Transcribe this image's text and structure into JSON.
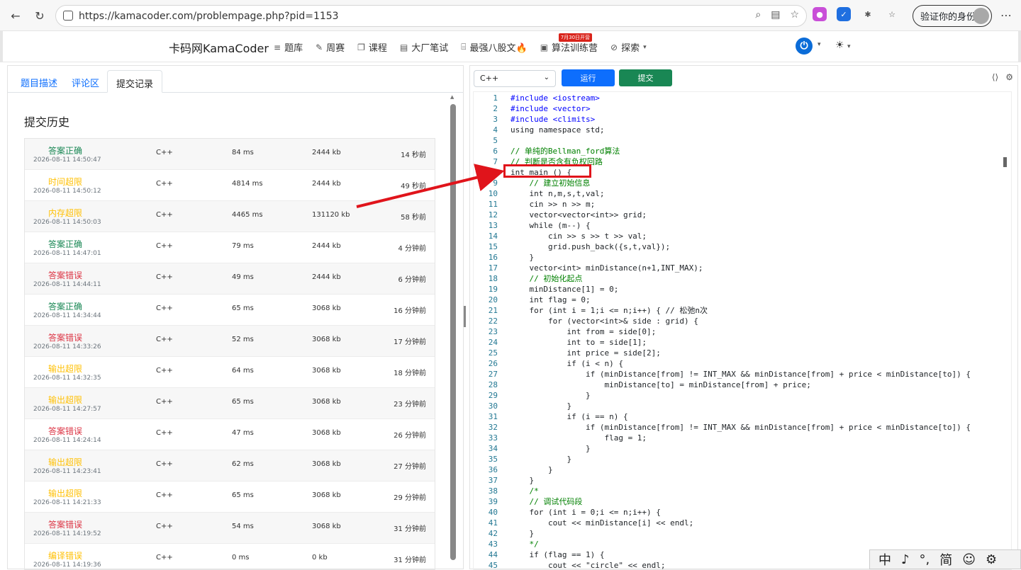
{
  "browser": {
    "url": "https://kamacoder.com/problempage.php?pid=1153",
    "profile_button": "验证你的身份"
  },
  "site": {
    "brand": "卡码网KamaCoder",
    "nav": [
      {
        "label": "题库",
        "icon": "list-icon"
      },
      {
        "label": "周赛",
        "icon": "pen-icon"
      },
      {
        "label": "课程",
        "icon": "book-icon"
      },
      {
        "label": "大厂笔试",
        "icon": "exam-icon"
      },
      {
        "label": "最强八股文🔥",
        "icon": "code-icon"
      },
      {
        "label": "算法训练营",
        "icon": "calendar-icon",
        "badge": "7月30日开营"
      },
      {
        "label": "探索",
        "icon": "compass-icon"
      }
    ]
  },
  "left": {
    "tabs": [
      "题目描述",
      "评论区",
      "提交记录"
    ],
    "active_tab": 2,
    "history_title": "提交历史",
    "submissions": [
      {
        "status": "答案正确",
        "color": "green",
        "time": "2026-08-11 14:50:47",
        "lang": "C++",
        "runtime": "84 ms",
        "memory": "2444 kb",
        "ago": "14 秒前"
      },
      {
        "status": "时间超限",
        "color": "orange",
        "time": "2026-08-11 14:50:12",
        "lang": "C++",
        "runtime": "4814 ms",
        "memory": "2444 kb",
        "ago": "49 秒前"
      },
      {
        "status": "内存超限",
        "color": "orange",
        "time": "2026-08-11 14:50:03",
        "lang": "C++",
        "runtime": "4465 ms",
        "memory": "131120 kb",
        "ago": "58 秒前"
      },
      {
        "status": "答案正确",
        "color": "green",
        "time": "2026-08-11 14:47:01",
        "lang": "C++",
        "runtime": "79 ms",
        "memory": "2444 kb",
        "ago": "4 分钟前"
      },
      {
        "status": "答案错误",
        "color": "red",
        "time": "2026-08-11 14:44:11",
        "lang": "C++",
        "runtime": "49 ms",
        "memory": "2444 kb",
        "ago": "6 分钟前"
      },
      {
        "status": "答案正确",
        "color": "green",
        "time": "2026-08-11 14:34:44",
        "lang": "C++",
        "runtime": "65 ms",
        "memory": "3068 kb",
        "ago": "16 分钟前"
      },
      {
        "status": "答案错误",
        "color": "red",
        "time": "2026-08-11 14:33:26",
        "lang": "C++",
        "runtime": "52 ms",
        "memory": "3068 kb",
        "ago": "17 分钟前"
      },
      {
        "status": "输出超限",
        "color": "orange",
        "time": "2026-08-11 14:32:35",
        "lang": "C++",
        "runtime": "64 ms",
        "memory": "3068 kb",
        "ago": "18 分钟前"
      },
      {
        "status": "输出超限",
        "color": "orange",
        "time": "2026-08-11 14:27:57",
        "lang": "C++",
        "runtime": "65 ms",
        "memory": "3068 kb",
        "ago": "23 分钟前"
      },
      {
        "status": "答案错误",
        "color": "red",
        "time": "2026-08-11 14:24:14",
        "lang": "C++",
        "runtime": "47 ms",
        "memory": "3068 kb",
        "ago": "26 分钟前"
      },
      {
        "status": "输出超限",
        "color": "orange",
        "time": "2026-08-11 14:23:41",
        "lang": "C++",
        "runtime": "62 ms",
        "memory": "3068 kb",
        "ago": "27 分钟前"
      },
      {
        "status": "输出超限",
        "color": "orange",
        "time": "2026-08-11 14:21:33",
        "lang": "C++",
        "runtime": "65 ms",
        "memory": "3068 kb",
        "ago": "29 分钟前"
      },
      {
        "status": "答案错误",
        "color": "red",
        "time": "2026-08-11 14:19:52",
        "lang": "C++",
        "runtime": "54 ms",
        "memory": "3068 kb",
        "ago": "31 分钟前"
      },
      {
        "status": "编译错误",
        "color": "orange",
        "time": "2026-08-11 14:19:36",
        "lang": "C++",
        "runtime": "0 ms",
        "memory": "0 kb",
        "ago": "31 分钟前"
      }
    ]
  },
  "right": {
    "language": "C++",
    "run_label": "运行",
    "submit_label": "提交",
    "code_lines": [
      "#include <iostream>",
      "#include <vector>",
      "#include <climits>",
      "using namespace std;",
      "",
      "// 单纯的Bellman_ford算法",
      "// 判断是否含有负权回路",
      "int main () {",
      "    // 建立初始信息",
      "    int n,m,s,t,val;",
      "    cin >> n >> m;",
      "    vector<vector<int>> grid;",
      "    while (m--) {",
      "        cin >> s >> t >> val;",
      "        grid.push_back({s,t,val});",
      "    }",
      "    vector<int> minDistance(n+1,INT_MAX);",
      "    // 初始化起点",
      "    minDistance[1] = 0;",
      "    int flag = 0;",
      "    for (int i = 1;i <= n;i++) { // 松弛n次",
      "        for (vector<int>& side : grid) {",
      "            int from = side[0];",
      "            int to = side[1];",
      "            int price = side[2];",
      "            if (i < n) {",
      "                if (minDistance[from] != INT_MAX && minDistance[from] + price < minDistance[to]) {",
      "                    minDistance[to] = minDistance[from] + price;",
      "                }",
      "            }",
      "            if (i == n) {",
      "                if (minDistance[from] != INT_MAX && minDistance[from] + price < minDistance[to]) {",
      "                    flag = 1;",
      "                }",
      "            }",
      "        }",
      "    }",
      "    /*",
      "    // 调试代码段",
      "    for (int i = 0;i <= n;i++) {",
      "        cout << minDistance[i] << endl;",
      "    }",
      "    */",
      "    if (flag == 1) {",
      "        cout << \"circle\" << endl;"
    ]
  },
  "ime": [
    "中",
    "♪",
    "°,",
    "简",
    "☺",
    "⚙"
  ]
}
